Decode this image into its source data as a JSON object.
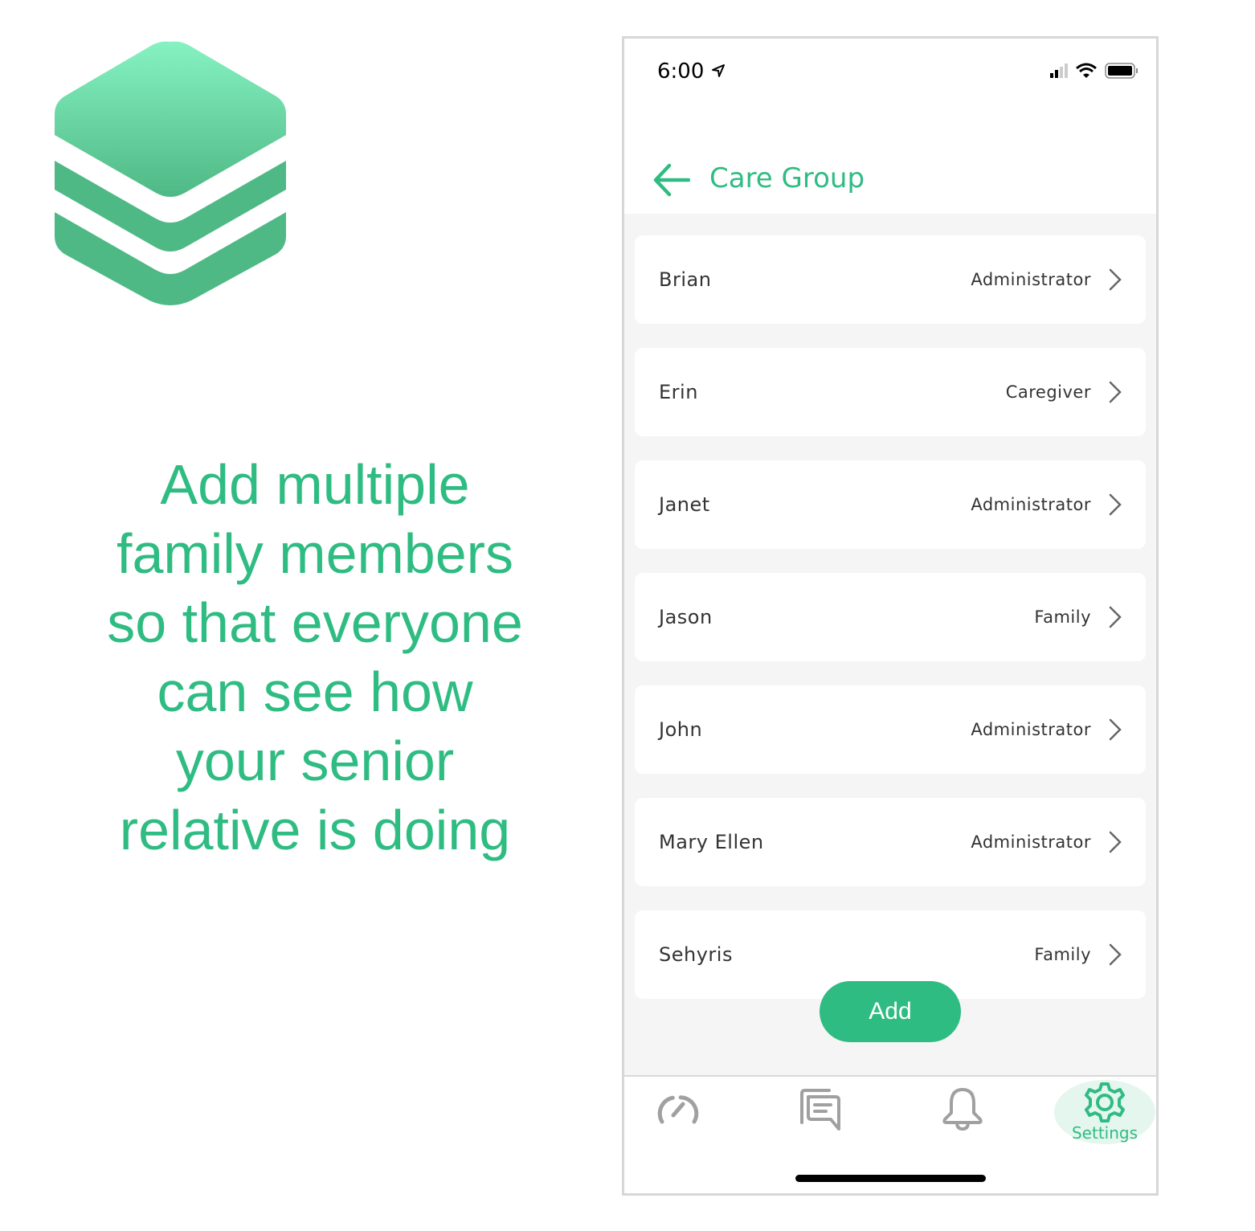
{
  "tagline": [
    "Add multiple",
    "family members",
    "so that everyone",
    "can see how",
    "your senior",
    "relative is doing"
  ],
  "status_bar": {
    "time": "6:00"
  },
  "header": {
    "title": "Care Group"
  },
  "members": [
    {
      "name": "Brian",
      "role": "Administrator"
    },
    {
      "name": "Erin",
      "role": "Caregiver"
    },
    {
      "name": "Janet",
      "role": "Administrator"
    },
    {
      "name": "Jason",
      "role": "Family"
    },
    {
      "name": "John",
      "role": "Administrator"
    },
    {
      "name": "Mary Ellen",
      "role": "Administrator"
    },
    {
      "name": "Sehyris",
      "role": "Family"
    }
  ],
  "add_label": "Add",
  "tabs": {
    "settings": "Settings",
    "active": "settings"
  },
  "colors": {
    "accent": "#2fbc82",
    "inactive_icon": "#a0a0a0"
  }
}
